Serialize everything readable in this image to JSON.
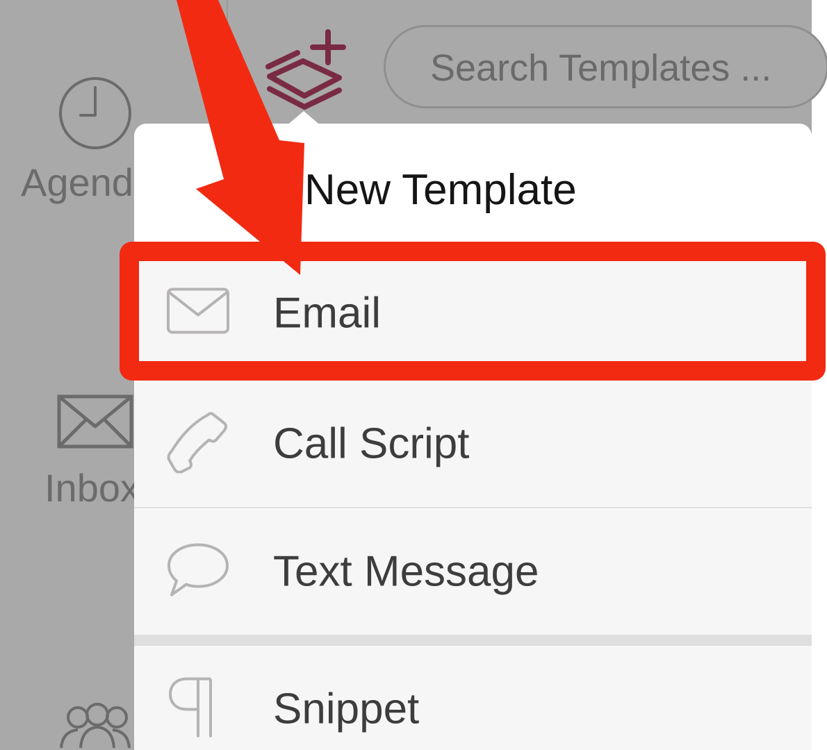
{
  "sidebar": {
    "items": [
      {
        "label": "Agenda",
        "icon": "clock-icon"
      },
      {
        "label": "Inbox",
        "icon": "envelope-icon"
      },
      {
        "label": "",
        "icon": "people-icon"
      }
    ]
  },
  "toolbar": {
    "new_template_icon": "layers-plus-icon",
    "search_placeholder": "Search Templates ..."
  },
  "popover": {
    "title": "New Template",
    "items": [
      {
        "label": "Email",
        "icon": "envelope-icon"
      },
      {
        "label": "Call Script",
        "icon": "phone-icon"
      },
      {
        "label": "Text Message",
        "icon": "speech-bubble-icon"
      },
      {
        "label": "Snippet",
        "icon": "pilcrow-icon"
      }
    ]
  },
  "colors": {
    "accent": "#7a2b44",
    "annotation": "#f22a12",
    "backdrop": "#a9a9a9",
    "popover_bg": "#f7f6f6"
  }
}
